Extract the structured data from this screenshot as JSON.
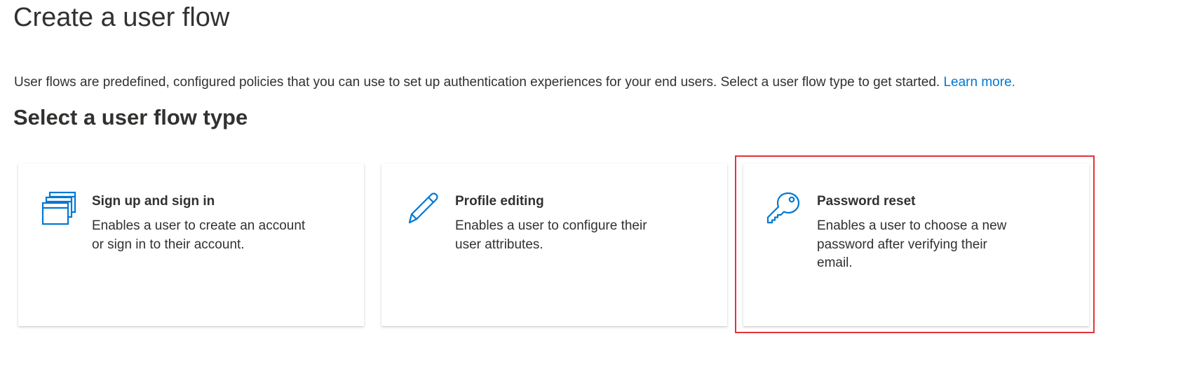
{
  "page": {
    "title": "Create a user flow",
    "intro_text": "User flows are predefined, configured policies that you can use to set up authentication experiences for your end users. Select a user flow type to get started.",
    "learn_more_label": "Learn more.",
    "section_title": "Select a user flow type"
  },
  "cards": [
    {
      "title": "Sign up and sign in",
      "description": "Enables a user to create an account or sign in to their account.",
      "icon": "windows-icon"
    },
    {
      "title": "Profile editing",
      "description": "Enables a user to configure their user attributes.",
      "icon": "pencil-icon"
    },
    {
      "title": "Password reset",
      "description": "Enables a user to choose a new password after verifying their email.",
      "icon": "key-icon",
      "highlighted": true
    }
  ],
  "colors": {
    "accent": "#0078d4",
    "text": "#323130",
    "highlight": "#e3343a"
  }
}
